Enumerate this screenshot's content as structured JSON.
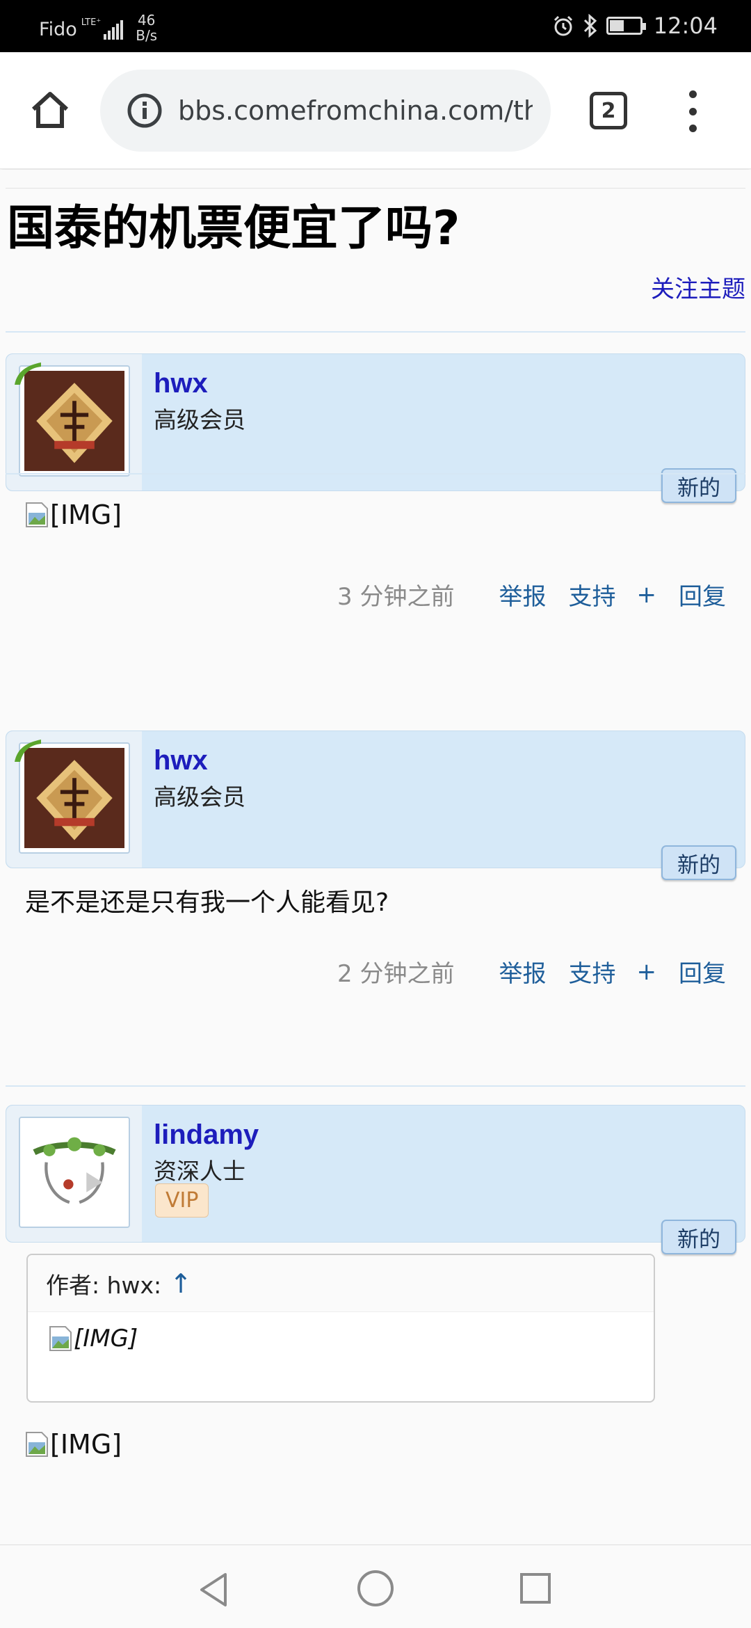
{
  "status_bar": {
    "carrier": "Fido",
    "network": "LTE⁺",
    "speed_value": "46",
    "speed_unit": "B/s",
    "time": "12:04",
    "battery_level_fraction": 0.45
  },
  "browser": {
    "url": "bbs.comefromchina.com/th",
    "tab_count": "2",
    "icons": {
      "home": "home-icon",
      "info": "info-icon",
      "menu": "more-vert-icon"
    }
  },
  "thread": {
    "title": "国泰的机票便宜了吗?",
    "follow_label": "关注主题"
  },
  "posts": [
    {
      "username": "hwx",
      "user_title": "高级会员",
      "new_label": "新的",
      "content_img": "[IMG]",
      "time": "3 分钟之前",
      "report": "举报",
      "like": "支持",
      "plus": "+",
      "reply": "回复"
    },
    {
      "username": "hwx",
      "user_title": "高级会员",
      "new_label": "新的",
      "content_text": "是不是还是只有我一个人能看见?",
      "time": "2 分钟之前",
      "report": "举报",
      "like": "支持",
      "plus": "+",
      "reply": "回复"
    },
    {
      "username": "lindamy",
      "user_title": "资深人士",
      "badge": "VIP",
      "new_label": "新的",
      "quote_author": "作者: hwx:",
      "quote_arrow": "↑",
      "quote_img": "[IMG]",
      "content_img": "[IMG]"
    }
  ],
  "colors": {
    "link": "#1d1dbc",
    "action": "#1e5e9a",
    "header_bg": "#d6e9f8",
    "online": "#5aa52c"
  }
}
